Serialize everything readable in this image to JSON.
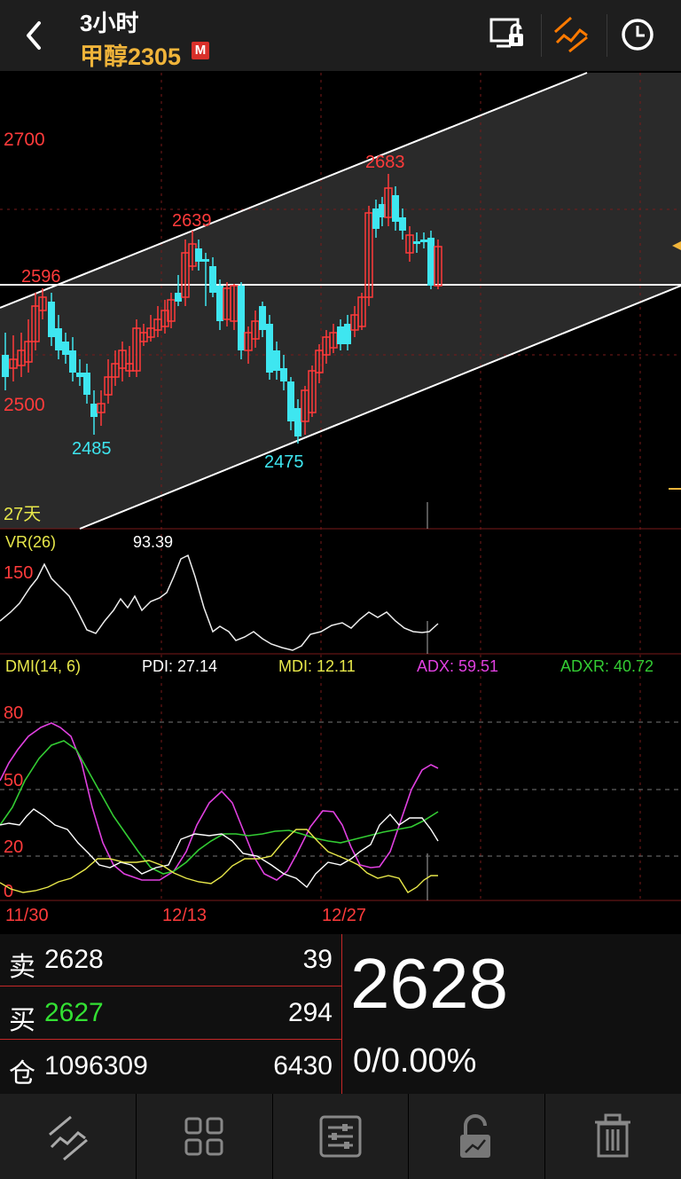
{
  "header": {
    "title": "3小时",
    "instrument": "甲醇2305",
    "badge": "M",
    "icons": [
      "back-icon",
      "screen-unlock-icon",
      "trend-line-icon",
      "clock-icon"
    ],
    "accent": "#f0b43a",
    "active_color": "#ff7a00"
  },
  "main_chart": {
    "price_labels": [
      "2700",
      "2500"
    ],
    "annotations": {
      "peak_2596": "2596",
      "peak_2639": "2639",
      "peak_2683": "2683",
      "low_2485": "2485",
      "low_2475": "2475"
    },
    "period_label": "27天",
    "y_range": [
      2460,
      2740
    ],
    "up_color": "#ff3b3b",
    "down_color": "#3ee6f0"
  },
  "vr": {
    "label": "VR(26)",
    "value": "93.39",
    "level": "150"
  },
  "dmi": {
    "label": "DMI(14, 6)",
    "pdi": "PDI: 27.14",
    "mdi": "MDI: 12.11",
    "adx": "ADX: 59.51",
    "adxr": "ADXR: 40.72",
    "levels": [
      "80",
      "50",
      "20",
      "0"
    ],
    "colors": {
      "pdi": "#ffffff",
      "mdi": "#e8e84a",
      "adx": "#e040e0",
      "adxr": "#33cc33"
    }
  },
  "x_axis": {
    "dates": [
      "11/30",
      "12/13",
      "12/27"
    ]
  },
  "quote": {
    "sell_label": "卖",
    "sell_price": "2628",
    "sell_qty": "39",
    "buy_label": "买",
    "buy_price": "2627",
    "buy_qty": "294",
    "oi_label": "仓",
    "open_interest": "1096309",
    "oi_change": "6430",
    "last_price": "2628",
    "change": "0/0.00%",
    "buy_color": "#33e033"
  },
  "toolbar": {
    "icons": [
      "drawing-tool-icon",
      "grid-layout-icon",
      "settings-sliders-icon",
      "lock-icon",
      "trash-icon"
    ]
  }
}
